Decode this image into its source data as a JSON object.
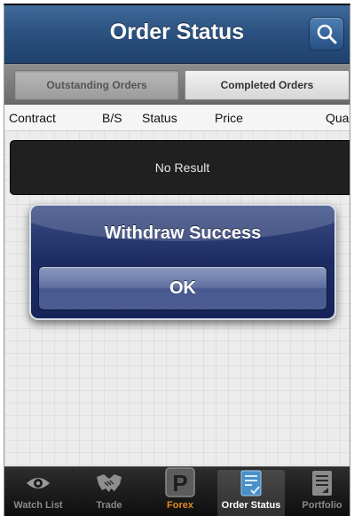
{
  "navbar": {
    "title": "Order Status"
  },
  "segments": {
    "outstanding": "Outstanding Orders",
    "completed": "Completed Orders"
  },
  "columns": [
    "Contract",
    "B/S",
    "Status",
    "Price",
    "Quar"
  ],
  "results": {
    "empty_text": "No Result"
  },
  "alert": {
    "title": "Withdraw Success",
    "ok_label": "OK"
  },
  "tabbar": {
    "items": [
      {
        "label": "Watch List",
        "icon": "eye-icon"
      },
      {
        "label": "Trade",
        "icon": "handshake-icon"
      },
      {
        "label": "Forex",
        "icon": "forex-p-icon"
      },
      {
        "label": "Order Status",
        "icon": "order-list-icon",
        "active": true
      },
      {
        "label": "Portfolio",
        "icon": "portfolio-doc-icon"
      }
    ]
  },
  "colors": {
    "nav_blue": "#2c5281",
    "alert_blue": "#1c2c63",
    "forex_orange": "#e58a1f"
  }
}
